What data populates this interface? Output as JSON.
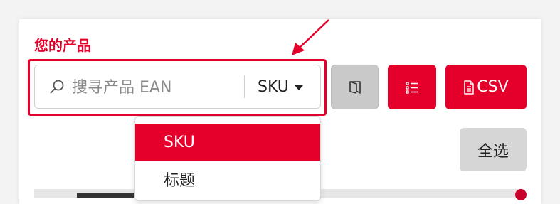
{
  "section": {
    "title": "您的产品"
  },
  "search": {
    "placeholder": "搜寻产品 EAN",
    "value": ""
  },
  "field_select": {
    "selected": "SKU",
    "options": [
      "SKU",
      "标题"
    ]
  },
  "toolbar": {
    "columns_icon": "columns-icon",
    "list_icon": "list-icon",
    "csv_icon": "file-icon",
    "csv_label": "CSV",
    "select_all_label": "全选"
  },
  "annotation": {
    "highlight_color": "#e4002b",
    "arrow_color": "#e4002b"
  },
  "colors": {
    "accent": "#e4002b",
    "muted_button": "#c9c9c9"
  }
}
